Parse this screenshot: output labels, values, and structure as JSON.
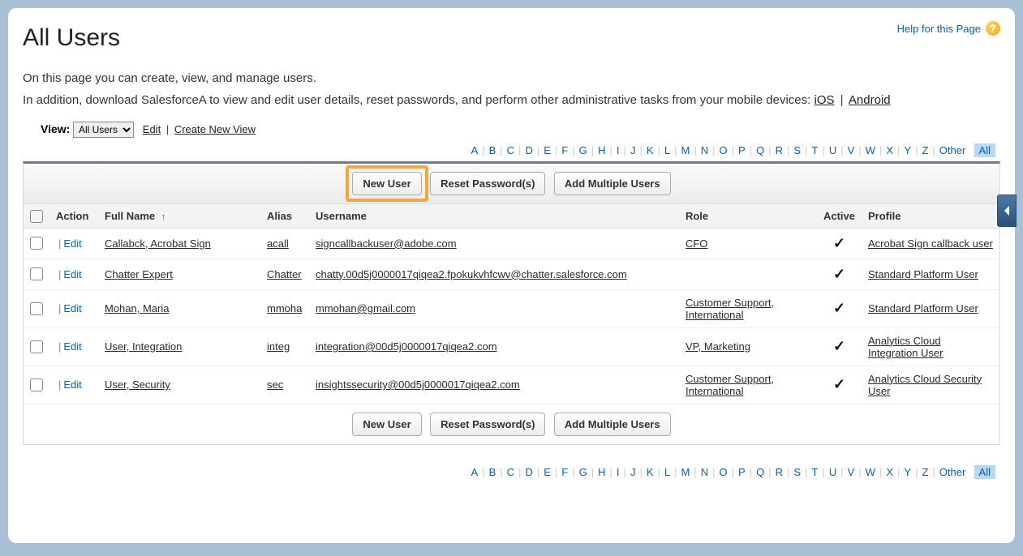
{
  "header": {
    "title": "All Users",
    "helpText": "Help for this Page"
  },
  "intro": {
    "line1": "On this page you can create, view, and manage users.",
    "line2_prefix": "In addition, download SalesforceA to view and edit user details, reset passwords, and perform other administrative tasks from your mobile devices: ",
    "link_ios": "iOS",
    "link_android": "Android"
  },
  "view": {
    "label": "View:",
    "selected": "All Users",
    "editLabel": "Edit",
    "createLabel": "Create New View"
  },
  "alpha": {
    "letters": [
      "A",
      "B",
      "C",
      "D",
      "E",
      "F",
      "G",
      "H",
      "I",
      "J",
      "K",
      "L",
      "M",
      "N",
      "O",
      "P",
      "Q",
      "R",
      "S",
      "T",
      "U",
      "V",
      "W",
      "X",
      "Y",
      "Z"
    ],
    "other": "Other",
    "all": "All"
  },
  "toolbar": {
    "newUser": "New User",
    "resetPw": "Reset Password(s)",
    "addMulti": "Add Multiple Users"
  },
  "cols": {
    "action": "Action",
    "fullName": "Full Name",
    "alias": "Alias",
    "username": "Username",
    "role": "Role",
    "active": "Active",
    "profile": "Profile"
  },
  "editLabel": "Edit",
  "rows": [
    {
      "fullName": "Callabck, Acrobat Sign",
      "alias": "acall",
      "username": "signcallbackuser@adobe.com",
      "role": "CFO",
      "active": true,
      "profile": "Acrobat Sign callback user"
    },
    {
      "fullName": "Chatter Expert",
      "alias": "Chatter",
      "username": "chatty.00d5j0000017qiqea2.fpokukvhfcwv@chatter.salesforce.com",
      "role": "",
      "active": true,
      "profile": "Standard Platform User"
    },
    {
      "fullName": "Mohan, Maria",
      "alias": "mmoha",
      "username": "mmohan@gmail.com",
      "role": "Customer Support, International",
      "active": true,
      "profile": "Standard Platform User"
    },
    {
      "fullName": "User, Integration",
      "alias": "integ",
      "username": "integration@00d5j0000017qiqea2.com",
      "role": "VP, Marketing",
      "active": true,
      "profile": "Analytics Cloud Integration User"
    },
    {
      "fullName": "User, Security",
      "alias": "sec",
      "username": "insightssecurity@00d5j0000017qiqea2.com",
      "role": "Customer Support, International",
      "active": true,
      "profile": "Analytics Cloud Security User"
    }
  ]
}
